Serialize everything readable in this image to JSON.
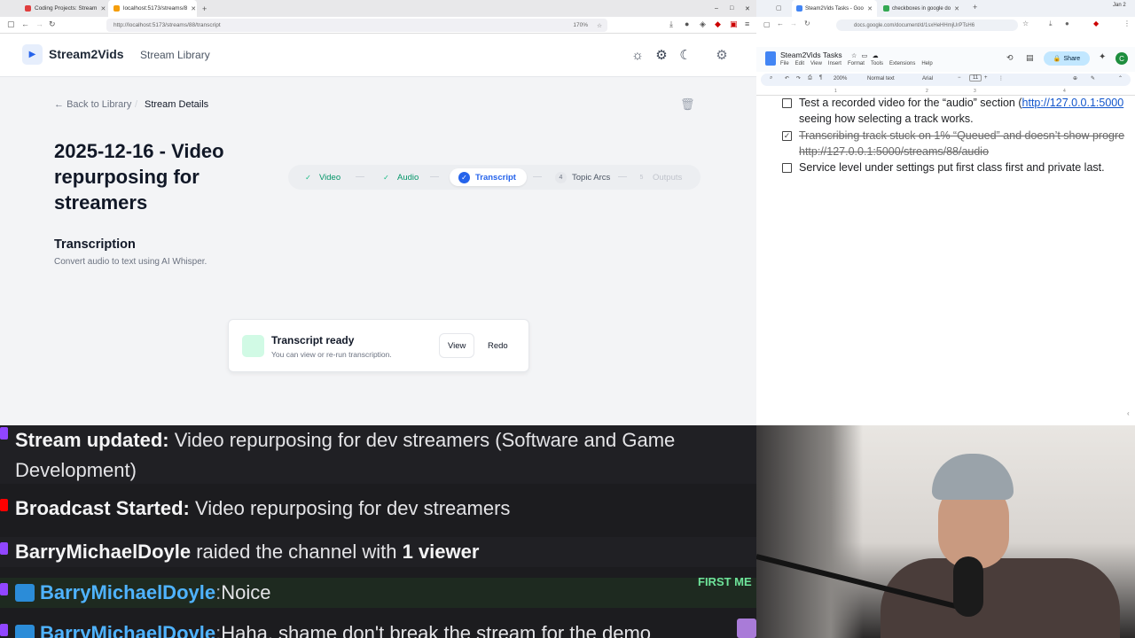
{
  "left_browser": {
    "tabs": [
      {
        "label": "Coding Projects: Stream"
      },
      {
        "label": "localhost:5173/streams/8"
      }
    ],
    "url": "http://localhost:5173/streams/88/transcript",
    "zoom": "170%",
    "app": {
      "brand": "Stream2Vids",
      "nav_library": "Stream Library",
      "breadcrumb_back": "Back to Library",
      "breadcrumb_current": "Stream Details",
      "title": "2025-12-16 - Video repurposing for streamers",
      "steps": [
        {
          "label": "Video",
          "state": "done"
        },
        {
          "label": "Audio",
          "state": "done"
        },
        {
          "label": "Transcript",
          "state": "active"
        },
        {
          "label": "Topic Arcs",
          "state": "pending",
          "num": "4"
        },
        {
          "label": "Outputs",
          "state": "disabled",
          "num": "5"
        }
      ],
      "section_title": "Transcription",
      "section_subtitle": "Convert audio to text using AI Whisper.",
      "card_title": "Transcript ready",
      "card_subtitle": "You can view or re-run transcription.",
      "view_label": "View",
      "redo_label": "Redo"
    }
  },
  "right_browser": {
    "tabs": [
      {
        "label": "Steam2Vids Tasks - Goo"
      },
      {
        "label": "checkboxes in google do"
      }
    ],
    "clock": "Jan 2",
    "url": "docs.google.com/document/d/1sxHeHHmjUrPTsH6",
    "doc_title": "Steam2Vids Tasks",
    "menu": [
      "File",
      "Edit",
      "View",
      "Insert",
      "Format",
      "Tools",
      "Extensions",
      "Help"
    ],
    "share_label": "Share",
    "avatar_letter": "C",
    "toolbar": {
      "zoom": "200%",
      "style": "Normal text",
      "font": "Arial",
      "size": "11"
    },
    "ruler": [
      "1",
      "2",
      "3",
      "4"
    ],
    "items": [
      {
        "line1_text": "Test a recorded video for the “audio” section (",
        "line1_link": "http://127.0.0.1:5000",
        "line2": "seeing how selecting a track works.",
        "checked": false
      },
      {
        "line1": "Transcribing track stuck on 1% “Queued” and doesn’t show progre",
        "line2": "http://127.0.0.1:5000/streams/88/audio",
        "checked": true
      },
      {
        "line1": "Service level under settings put first class first and private last.",
        "checked": false
      }
    ]
  },
  "chat": {
    "messages": [
      {
        "bold": "Stream updated:",
        "text": " Video repurposing for dev streamers (Software and Game",
        "text2": "Development)"
      },
      {
        "bold": "Broadcast Started:",
        "text": " Video repurposing for dev streamers"
      },
      {
        "bold": "BarryMichaelDoyle",
        "text": " raided the channel with ",
        "bold2": "1 viewer"
      },
      {
        "user": "BarryMichaelDoyle",
        "text": "Noice"
      },
      {
        "user": "BarryMichaelDoyle",
        "text": "Haha, shame don't break the stream for the demo"
      }
    ],
    "first_badge": "FIRST ME"
  },
  "colors": {
    "accent": "#2563eb",
    "success": "#10b981",
    "twitch": "#9146ff",
    "youtube": "#ff0000"
  }
}
